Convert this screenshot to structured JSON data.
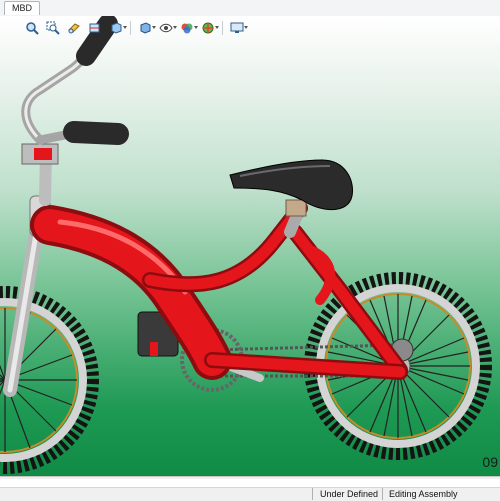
{
  "tabs": {
    "mbd": "MBD"
  },
  "toolbar": {
    "items": [
      "zoom-to-fit-icon",
      "zoom-to-area-icon",
      "previous-view-icon",
      "section-view-icon",
      "view-orientation-icon",
      "display-style-icon",
      "hide-show-items-icon",
      "edit-appearance-icon",
      "apply-scene-icon",
      "view-settings-icon"
    ]
  },
  "viewport": {
    "corner_text": "09"
  },
  "statusbar": {
    "definition_state": "Under Defined",
    "edit_mode": "Editing Assembly"
  },
  "colors": {
    "frame": "#e4161b",
    "tire": "#151515",
    "rim": "#dcdcdc",
    "saddle": "#2b2b2b",
    "grip": "#2a2a2a"
  }
}
